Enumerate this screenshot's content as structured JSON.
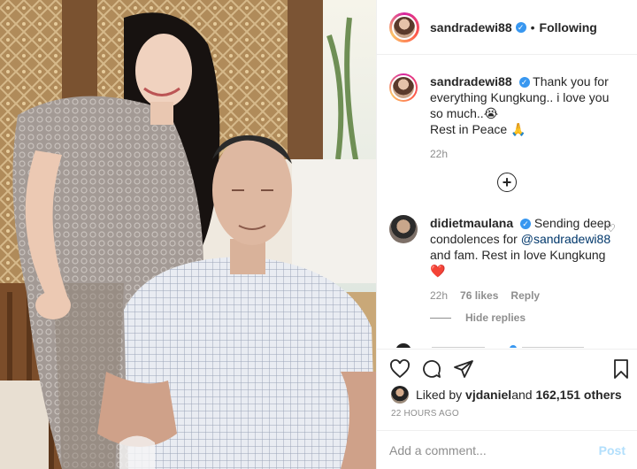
{
  "header": {
    "username": "sandradewi88",
    "verified": "✓",
    "separator": "•",
    "follow_status": "Following"
  },
  "caption": {
    "username": "sandradewi88",
    "text": "Thank you for everything Kungkung.. i love you so much..😭",
    "line2": "Rest in Peace 🙏",
    "time": "22h"
  },
  "load_more_icon": "plus-circle-icon",
  "comment": {
    "username": "didietmaulana",
    "verified": "✓",
    "text_before": "Sending deep condolences for ",
    "mention": "@sandradewi88",
    "text_after": " and fam. Rest in love Kungkung",
    "emoji": "❤️",
    "time": "22h",
    "likes": "76 likes",
    "reply": "Reply",
    "heart_icon": "♡"
  },
  "hide_replies": "Hide replies",
  "actions": {
    "like_icon": "heart-icon",
    "comment_icon": "comment-icon",
    "share_icon": "share-icon",
    "save_icon": "bookmark-icon"
  },
  "liked_by": {
    "prefix": "Liked by ",
    "user": "vjdaniel",
    "middle": " and ",
    "count": "162,151 others"
  },
  "timestamp": "22 HOURS AGO",
  "add_comment": {
    "placeholder": "Add a comment...",
    "post_label": "Post"
  },
  "colors": {
    "verified": "#3897f0",
    "muted": "#8e8e8e",
    "post_disabled": "#b2dffc",
    "mention": "#00376b"
  }
}
